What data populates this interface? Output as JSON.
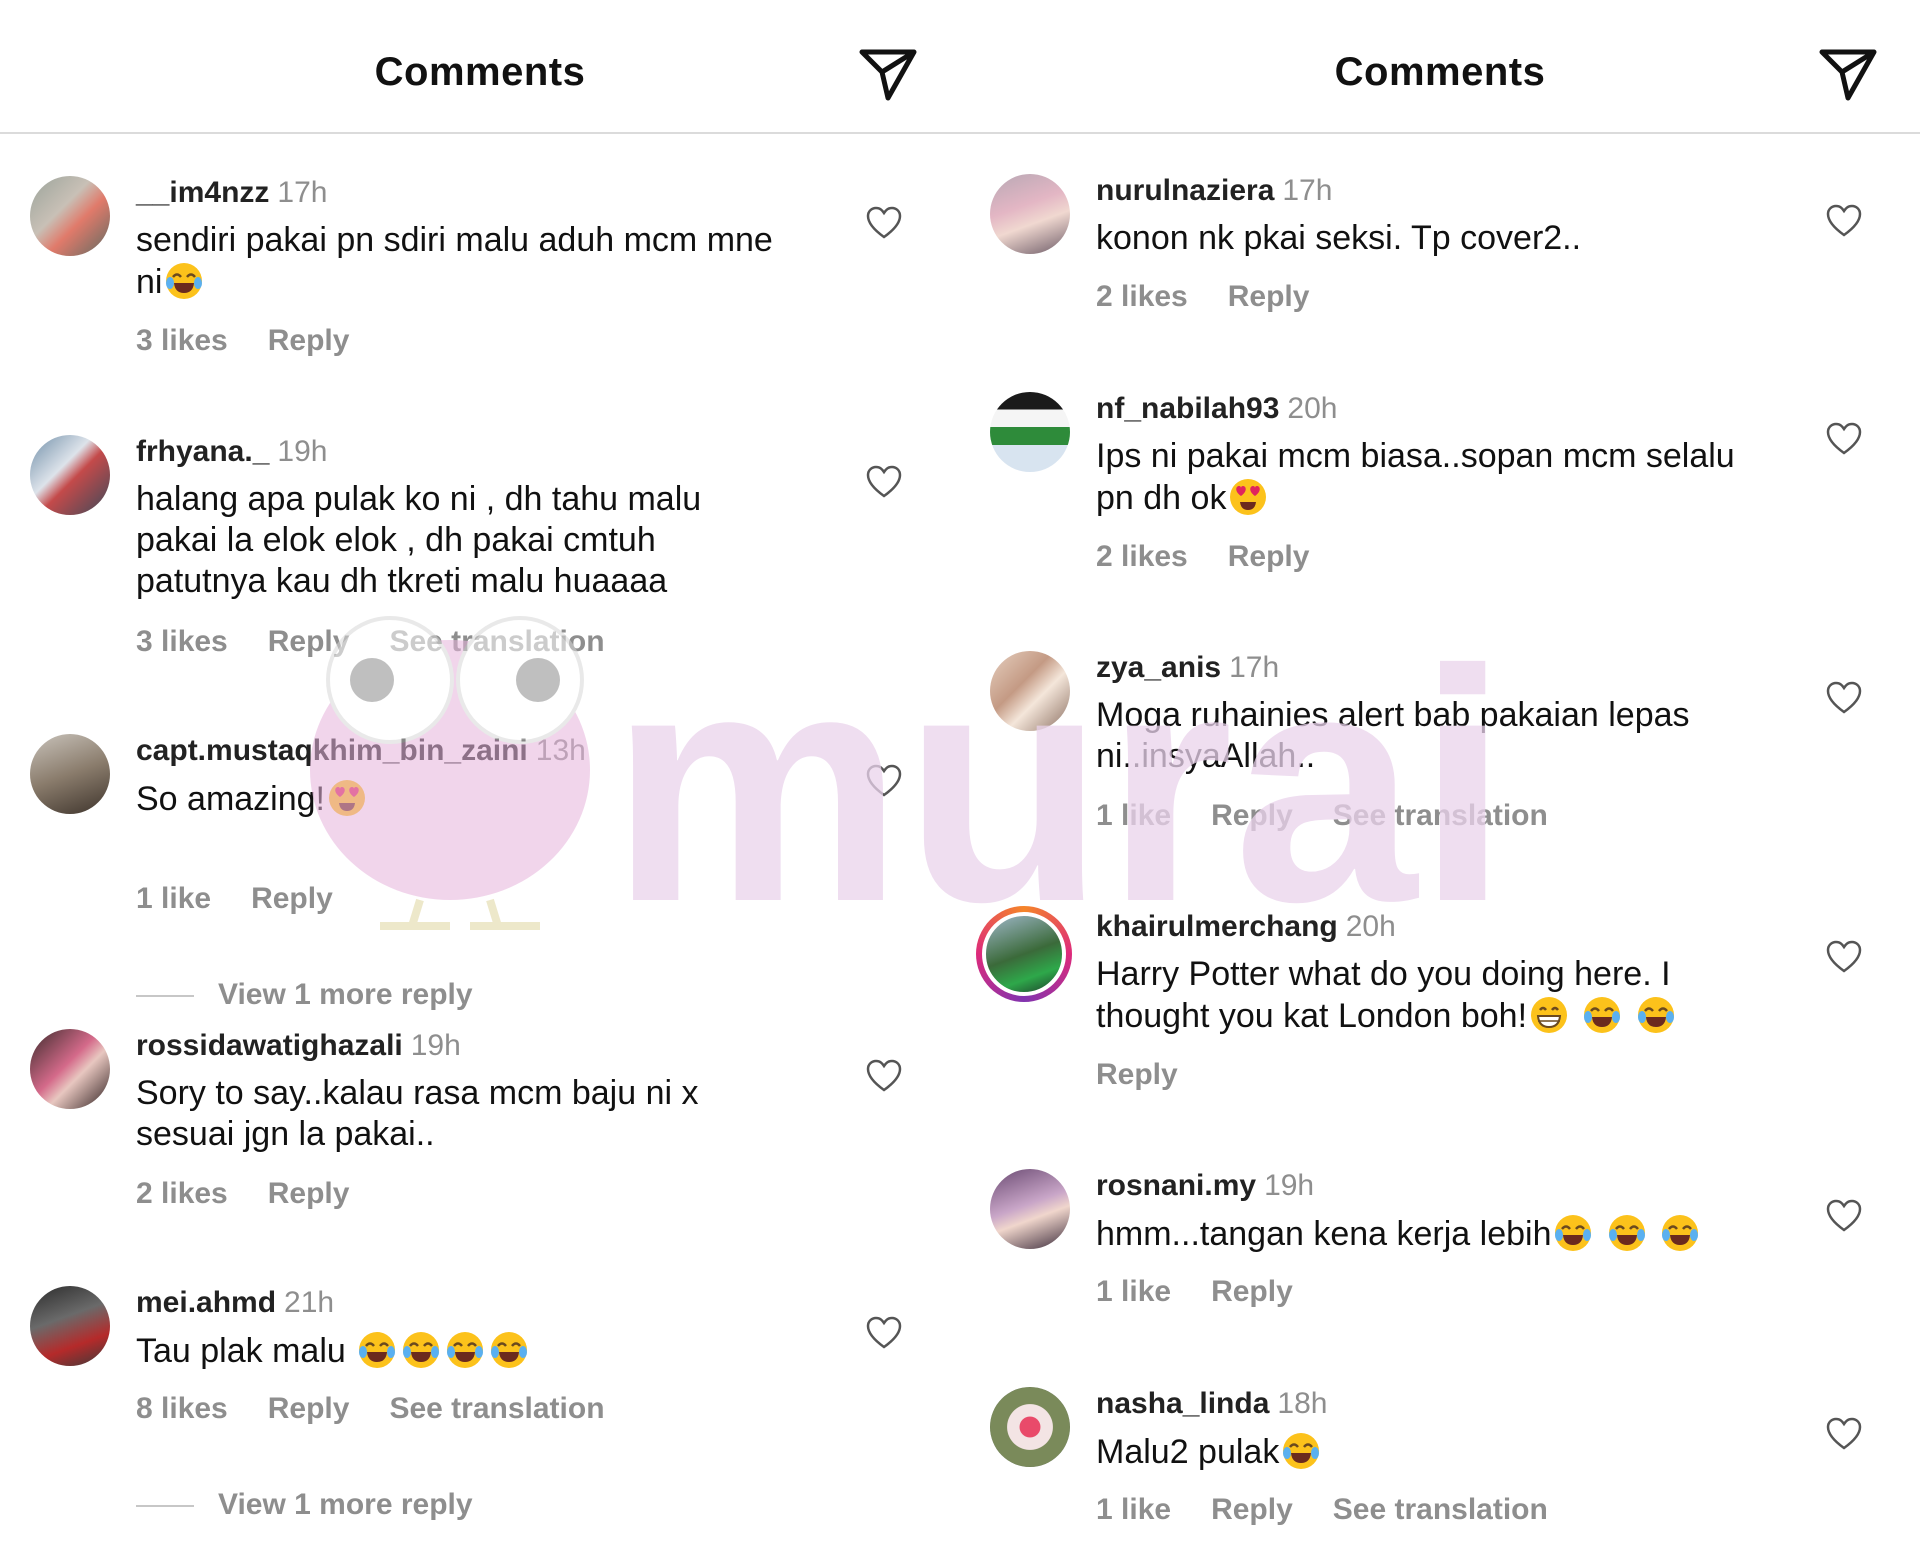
{
  "left": {
    "title": "Comments",
    "comments": [
      {
        "user": "__im4nzz",
        "time": "17h",
        "text": "sendiri pakai pn sdiri malu aduh mcm mne ni",
        "emojis": [
          "laugh-cry"
        ],
        "likes": "3 likes",
        "reply": "Reply",
        "translate": ""
      },
      {
        "user": "frhyana._",
        "time": "19h",
        "text": "halang apa pulak ko ni , dh tahu malu pakai la elok elok , dh pakai cmtuh patutnya kau dh tkreti malu huaaaa",
        "emojis": [],
        "likes": "3 likes",
        "reply": "Reply",
        "translate": "See translation"
      },
      {
        "user": "capt.mustaqkhim_bin_zaini",
        "time": "13h",
        "text": "So amazing!",
        "emojis": [
          "heart-eyes"
        ],
        "likes": "1 like",
        "reply": "Reply",
        "translate": "",
        "view_more": "View 1 more reply"
      },
      {
        "user": "rossidawatighazali",
        "time": "19h",
        "text": "Sory to say..kalau rasa mcm baju ni x sesuai jgn la pakai..",
        "emojis": [],
        "likes": "2 likes",
        "reply": "Reply",
        "translate": ""
      },
      {
        "user": "mei.ahmd",
        "time": "21h",
        "text": "Tau plak malu",
        "emojis": [
          "laugh-cry",
          "laugh-cry",
          "laugh-cry",
          "laugh-cry"
        ],
        "likes": "8 likes",
        "reply": "Reply",
        "translate": "See translation",
        "view_more": "View 1 more reply"
      }
    ]
  },
  "right": {
    "title": "Comments",
    "comments": [
      {
        "user": "nurulnaziera",
        "time": "17h",
        "text": "konon nk pkai seksi. Tp cover2..",
        "emojis": [],
        "likes": "2 likes",
        "reply": "Reply",
        "translate": ""
      },
      {
        "user": "nf_nabilah93",
        "time": "20h",
        "text": "Ips ni pakai mcm biasa..sopan mcm selalu pn dh ok",
        "emojis": [
          "heart-eyes"
        ],
        "likes": "2 likes",
        "reply": "Reply",
        "translate": ""
      },
      {
        "user": "zya_anis",
        "time": "17h",
        "text": "Moga ruhainies alert bab pakaian lepas ni..insyaAllah..",
        "emojis": [],
        "likes": "1 like",
        "reply": "Reply",
        "translate": "See translation"
      },
      {
        "user": "khairulmerchang",
        "time": "20h",
        "text": "Harry Potter what do you doing here. I thought you kat London boh!",
        "emojis": [
          "grin",
          "laugh-cry",
          "laugh-cry"
        ],
        "likes": "",
        "reply": "Reply",
        "translate": ""
      },
      {
        "user": "rosnani.my",
        "time": "19h",
        "text": "hmm...tangan kena kerja lebih",
        "emojis": [
          "laugh-cry",
          "laugh-cry",
          "laugh-cry"
        ],
        "likes": "1 like",
        "reply": "Reply",
        "translate": ""
      },
      {
        "user": "nasha_linda",
        "time": "18h",
        "text": "Malu2 pulak",
        "emojis": [
          "laugh-cry"
        ],
        "likes": "1 like",
        "reply": "Reply",
        "translate": "See translation"
      }
    ]
  },
  "icons": {
    "send": "paper-plane-icon",
    "like": "heart-outline-icon"
  },
  "watermark": {
    "text": "murai",
    "color": "#e9d6ea"
  },
  "colors": {
    "muted": "#8e8e8e",
    "divider": "#dbdbdb"
  }
}
